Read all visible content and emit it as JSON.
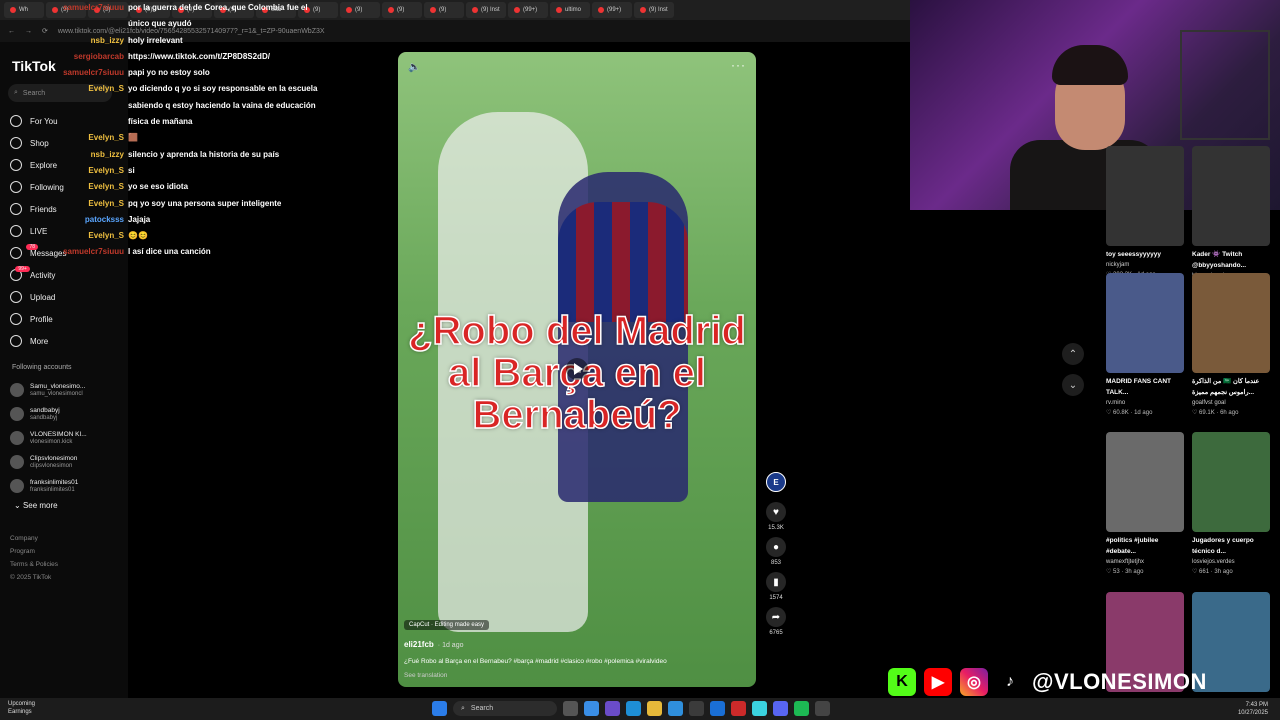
{
  "browser": {
    "tabs": [
      "Wh",
      "(9)",
      "(9)",
      "(9)",
      "(9)",
      "(9)",
      "Star",
      "(9)",
      "(9)",
      "(9)",
      "(9)",
      "(9) Inst",
      "(99+)",
      "ultimo",
      "(99+)",
      "(9) Inst"
    ],
    "url": "www.tiktok.com/@eli21fcb/video/7565428553257140977?_r=1&_t=ZP-90uaenWbZ3X"
  },
  "tiktok": {
    "logo": "TikTok",
    "search_placeholder": "Search",
    "nav": [
      {
        "label": "For You",
        "icon": "home-icon"
      },
      {
        "label": "Shop",
        "icon": "shop-icon"
      },
      {
        "label": "Explore",
        "icon": "compass-icon"
      },
      {
        "label": "Following",
        "icon": "following-icon"
      },
      {
        "label": "Friends",
        "icon": "friends-icon"
      },
      {
        "label": "LIVE",
        "icon": "live-icon"
      },
      {
        "label": "Messages",
        "icon": "messages-icon",
        "badge": "78"
      },
      {
        "label": "Activity",
        "icon": "activity-icon",
        "badge": "99+"
      },
      {
        "label": "Upload",
        "icon": "upload-icon"
      },
      {
        "label": "Profile",
        "icon": "profile-icon"
      },
      {
        "label": "More",
        "icon": "more-icon"
      }
    ],
    "following_heading": "Following accounts",
    "following": [
      {
        "name": "Samu_vlonesimo...",
        "handle": "samu_vlonesimoncl"
      },
      {
        "name": "sandbabyj",
        "handle": "sandbabyj"
      },
      {
        "name": "VLONESIMON KI...",
        "handle": "vlonesimon.kick"
      },
      {
        "name": "Clipsvlonesimon",
        "handle": "clipsvlonesimon"
      },
      {
        "name": "franksinlimites01",
        "handle": "franksinlimites01"
      }
    ],
    "see_more": "See more",
    "footer": [
      "Company",
      "Program",
      "Terms & Policies",
      "© 2025 TikTok"
    ]
  },
  "chat": [
    {
      "user": "samuelcr7siuuu",
      "text": "por la guerra del de Corea, que Colombia fue el único que ayudó",
      "color": "red"
    },
    {
      "user": "nsb_izzy",
      "text": "holy irrelevant",
      "color": "gold"
    },
    {
      "user": "sergiobarcab",
      "text": "https://www.tiktok.com/t/ZP8D8S2dD/",
      "color": "red"
    },
    {
      "user": "samuelcr7siuuu",
      "text": "papi yo no estoy solo",
      "color": "red"
    },
    {
      "user": "Evelyn_S",
      "text": "yo diciendo q yo si soy responsable en la escuela sabiendo q estoy haciendo la vaina de educación física de mañana",
      "color": "gold"
    },
    {
      "user": "Evelyn_S",
      "text": "🟫",
      "color": "gold"
    },
    {
      "user": "nsb_izzy",
      "text": "silencio y aprenda la historia de su país",
      "color": "gold"
    },
    {
      "user": "Evelyn_S",
      "text": "si",
      "color": "gold"
    },
    {
      "user": "Evelyn_S",
      "text": "yo se eso idiota",
      "color": "gold"
    },
    {
      "user": "Evelyn_S",
      "text": "pq yo soy una persona super inteligente",
      "color": "gold"
    },
    {
      "user": "patocksss",
      "text": "Jajaja",
      "color": "blue"
    },
    {
      "user": "Evelyn_S",
      "text": "😊😊",
      "color": "gold"
    },
    {
      "user": "samuelcr7siuuu",
      "text": "I así dice una canción",
      "color": "red"
    }
  ],
  "video": {
    "overlay_title": "¿Robo del Madrid al Barça en el Bernabeú?",
    "capcut": "CapCut · Editing made easy",
    "author": "eli21fcb",
    "time": "· 1d ago",
    "caption": "¿Fué Robo al Barça en el Bernabeu? #barça #madrid #clasico #robo #polemica #viralvideo",
    "see_translation": "See translation",
    "likes": "15.3K",
    "comments": "853",
    "saves": "1574",
    "shares": "6765"
  },
  "grid": [
    {
      "title": "toy seeessyyyyyy",
      "user": "nickyjam",
      "likes": "293.3K",
      "time": "1d ago",
      "color": "#333"
    },
    {
      "title": "Kader 👾 Twitch @bbyyoshando...",
      "user": "bbyyoshando",
      "likes": "222",
      "time": "51m ago",
      "color": "#333"
    },
    {
      "title": "MADRID FANS CANT TALK...",
      "user": "rv.mino",
      "likes": "60.8K",
      "time": "1d ago",
      "color": "#4a5a8a"
    },
    {
      "title": "من الذاكرة 🇸🇦 عندما كان ...راموس نجمهم مميزة",
      "user": "goalfvst goal",
      "likes": "69.1K",
      "time": "6h ago",
      "color": "#7a5a3a"
    },
    {
      "title": "#politics #jubilee #debate...",
      "user": "wamexftjtetjhx",
      "likes": "53",
      "time": "3h ago",
      "color": "#6a6a6a"
    },
    {
      "title": "Jugadores y cuerpo técnico d...",
      "user": "losviejos.verdes",
      "likes": "661",
      "time": "3h ago",
      "color": "#3d6a3d"
    },
    {
      "title": "",
      "user": "",
      "likes": "",
      "time": "",
      "color": "#8a3a6a"
    },
    {
      "title": "",
      "user": "",
      "likes": "",
      "time": "",
      "color": "#3a6a8a"
    }
  ],
  "overlay": {
    "handle": "@VLONESIMON"
  },
  "taskbar": {
    "weather_title": "Upcoming",
    "weather_sub": "Earnings",
    "search": "Search",
    "time": "7:43 PM",
    "date": "10/27/2025"
  }
}
